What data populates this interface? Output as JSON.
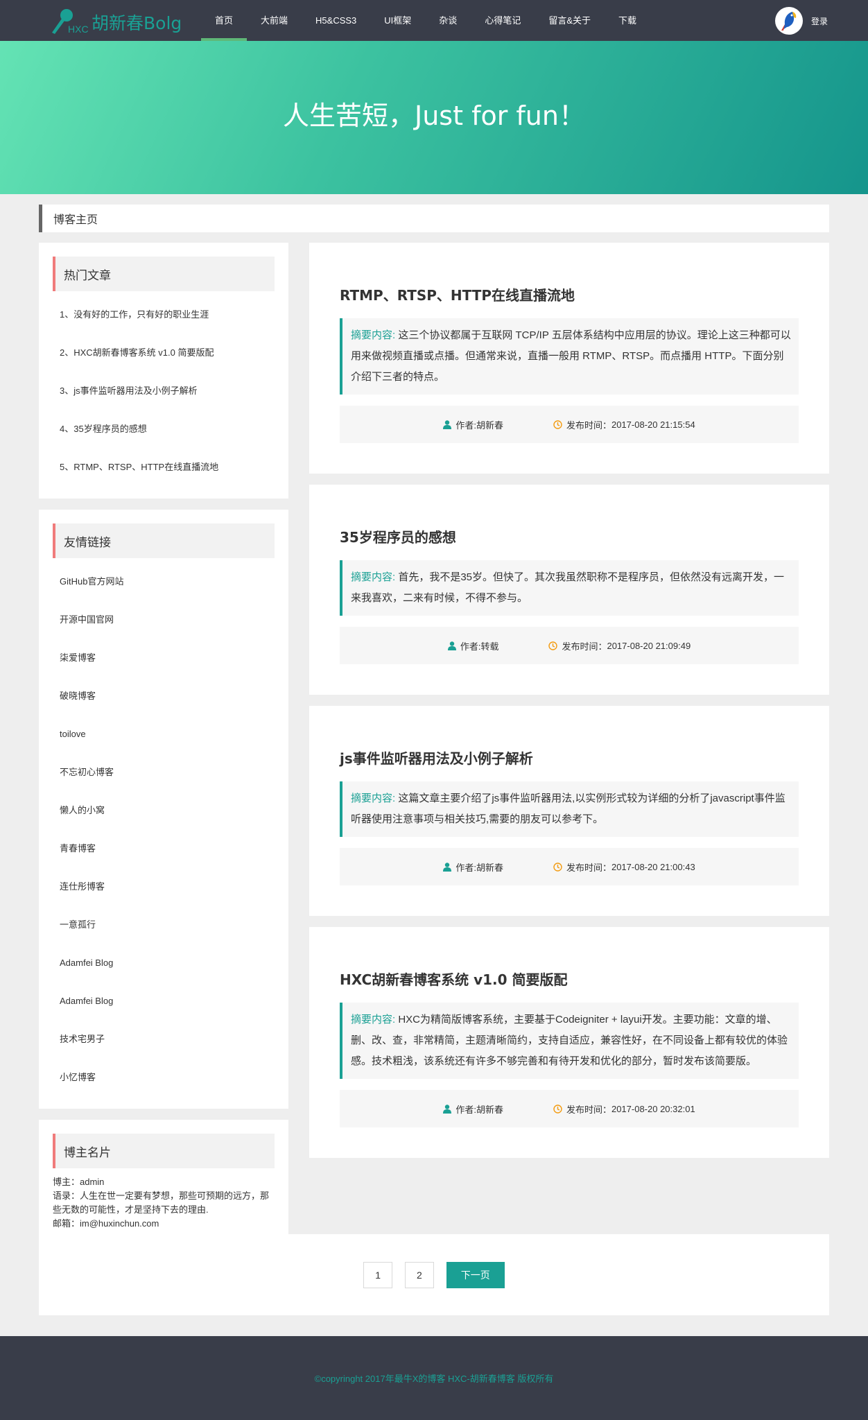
{
  "nav": {
    "brand": "胡新春Bolg",
    "brand_small": "HXC",
    "menu": [
      {
        "label": "首页",
        "active": true
      },
      {
        "label": "大前端",
        "active": false
      },
      {
        "label": "H5&CSS3",
        "active": false
      },
      {
        "label": "UI框架",
        "active": false
      },
      {
        "label": "杂谈",
        "active": false
      },
      {
        "label": "心得笔记",
        "active": false
      },
      {
        "label": "留言&关于",
        "active": false
      },
      {
        "label": "下载",
        "active": false
      }
    ],
    "login": "登录"
  },
  "banner": {
    "slogan": "人生苦短，Just for fun！"
  },
  "breadcrumb": {
    "label": "博客主页"
  },
  "hot": {
    "title": "热门文章",
    "items": [
      "1、没有好的工作，只有好的职业生涯",
      "2、HXC胡新春博客系统 v1.0 简要版配",
      "3、js事件监听器用法及小例子解析",
      "4、35岁程序员的感想",
      "5、RTMP、RTSP、HTTP在线直播流地"
    ]
  },
  "links": {
    "title": "友情链接",
    "items": [
      "GitHub官方网站",
      "开源中国官网",
      "柒爱博客",
      "破晓博客",
      "toilove",
      "不忘初心博客",
      "懒人的小窝",
      "青春博客",
      "连仕彤博客",
      "一意孤行",
      "Adamfei Blog",
      "Adamfei Blog",
      "技术宅男子",
      "小忆博客"
    ]
  },
  "owner": {
    "title": "博主名片",
    "name": "博主：admin",
    "motto": "语录：人生在世一定要有梦想，那些可预期的远方，那些无数的可能性，才是坚持下去的理由.",
    "email": "邮箱：im@huxinchun.com"
  },
  "summary_label": "摘要内容:",
  "author_prefix": "作者:",
  "time_prefix": "发布时间：",
  "articles": [
    {
      "title": "RTMP、RTSP、HTTP在线直播流地",
      "summary": "这三个协议都属于互联网 TCP/IP 五层体系结构中应用层的协议。理论上这三种都可以用来做视频直播或点播。但通常来说，直播一般用 RTMP、RTSP。而点播用 HTTP。下面分别介绍下三者的特点。",
      "author": "胡新春",
      "time": "2017-08-20 21:15:54"
    },
    {
      "title": "35岁程序员的感想",
      "summary": "首先，我不是35岁。但快了。其次我虽然职称不是程序员，但依然没有远离开发，一来我喜欢，二来有时候，不得不参与。",
      "author": "转载",
      "time": "2017-08-20 21:09:49"
    },
    {
      "title": "js事件监听器用法及小例子解析",
      "summary": "这篇文章主要介绍了js事件监听器用法,以实例形式较为详细的分析了javascript事件监听器使用注意事项与相关技巧,需要的朋友可以参考下。",
      "author": "胡新春",
      "time": "2017-08-20 21:00:43"
    },
    {
      "title": "HXC胡新春博客系统 v1.0 简要版配",
      "summary": "HXC为精简版博客系统，主要基于Codeigniter + layui开发。主要功能：文章的增、删、改、查，非常精简，主题清晰简约，支持自适应，兼容性好，在不同设备上都有较优的体验感。技术粗浅，该系统还有许多不够完善和有待开发和优化的部分，暂时发布该简要版。",
      "author": "胡新春",
      "time": "2017-08-20 20:32:01"
    }
  ],
  "pager": {
    "pages": [
      "1",
      "2"
    ],
    "next": "下一页"
  },
  "footer": {
    "text": "©copyringht 2017年最牛X的博客 HXC-胡新春博客 版权所有"
  },
  "colors": {
    "accent": "#1aa094",
    "nav_bg": "#393d49",
    "marker": "#f07b7b",
    "active_bar": "#5fb878"
  },
  "icons": {
    "author": "user-icon",
    "time": "clock-icon",
    "logo": "microphone-icon",
    "avatar": "parrot-icon"
  }
}
